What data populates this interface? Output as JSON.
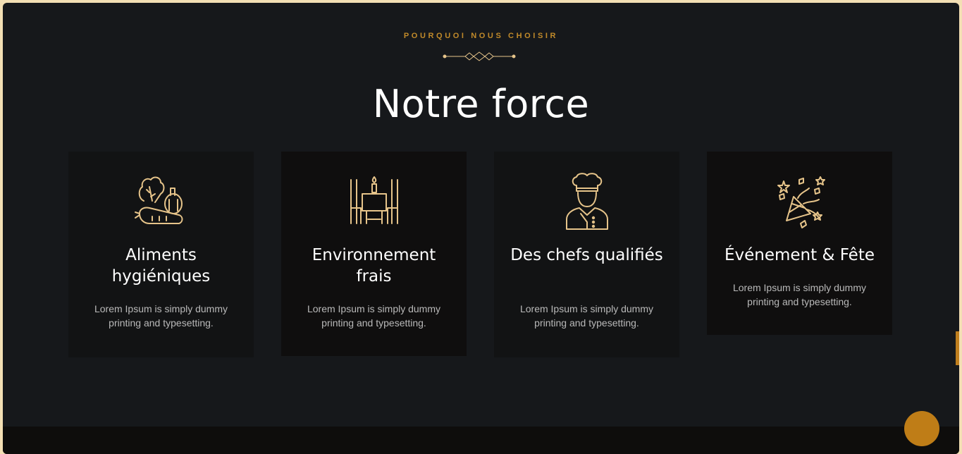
{
  "section": {
    "eyebrow": "POURQUOI NOUS CHOISIR",
    "title": "Notre force"
  },
  "colors": {
    "accent": "#c18a2a",
    "icon_stroke": "#e6c48a",
    "background": "#16181b",
    "card_bg": "#121314",
    "button": "#bf7d17"
  },
  "features": [
    {
      "icon": "vegetables-icon",
      "title": "Aliments hygiéniques",
      "desc": "Lorem Ipsum is simply dummy printing and typesetting."
    },
    {
      "icon": "dinner-table-icon",
      "title": "Environnement frais",
      "desc": "Lorem Ipsum is simply dummy printing and typesetting."
    },
    {
      "icon": "chef-icon",
      "title": "Des chefs qualifiés",
      "desc": "Lorem Ipsum is simply dummy printing and typesetting."
    },
    {
      "icon": "party-popper-icon",
      "title": "Événement & Fête",
      "desc": "Lorem Ipsum is simply dummy printing and typesetting."
    }
  ],
  "back_to_top": {
    "icon": "back-to-top-icon"
  }
}
